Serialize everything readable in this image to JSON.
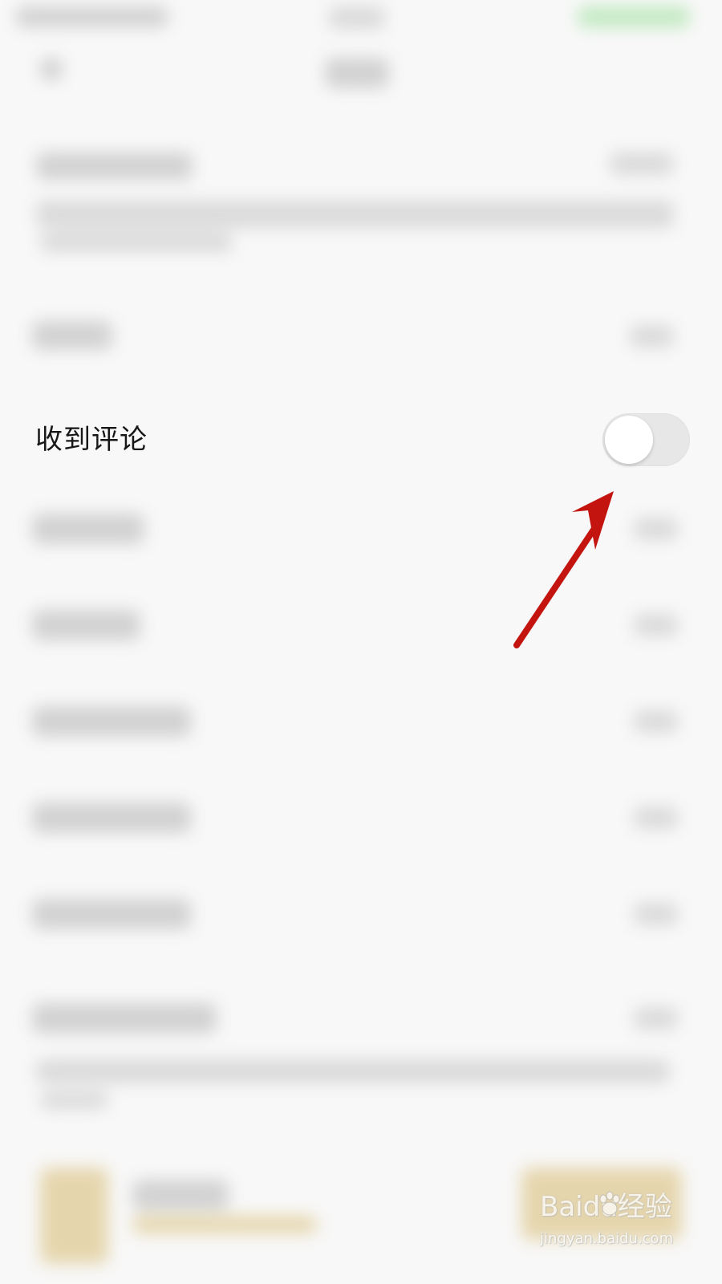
{
  "settings": {
    "received_comments": {
      "label": "收到评论",
      "enabled": false
    }
  },
  "annotation": {
    "color": "#c3140f",
    "icon": "red-arrow-icon"
  },
  "watermark": {
    "line1": "Baidu经验",
    "line2": "jingyan.baidu.com"
  },
  "colors": {
    "background": "#f8f8f8",
    "toggle_off": "#e7e7e7",
    "arrow": "#c3140f"
  }
}
